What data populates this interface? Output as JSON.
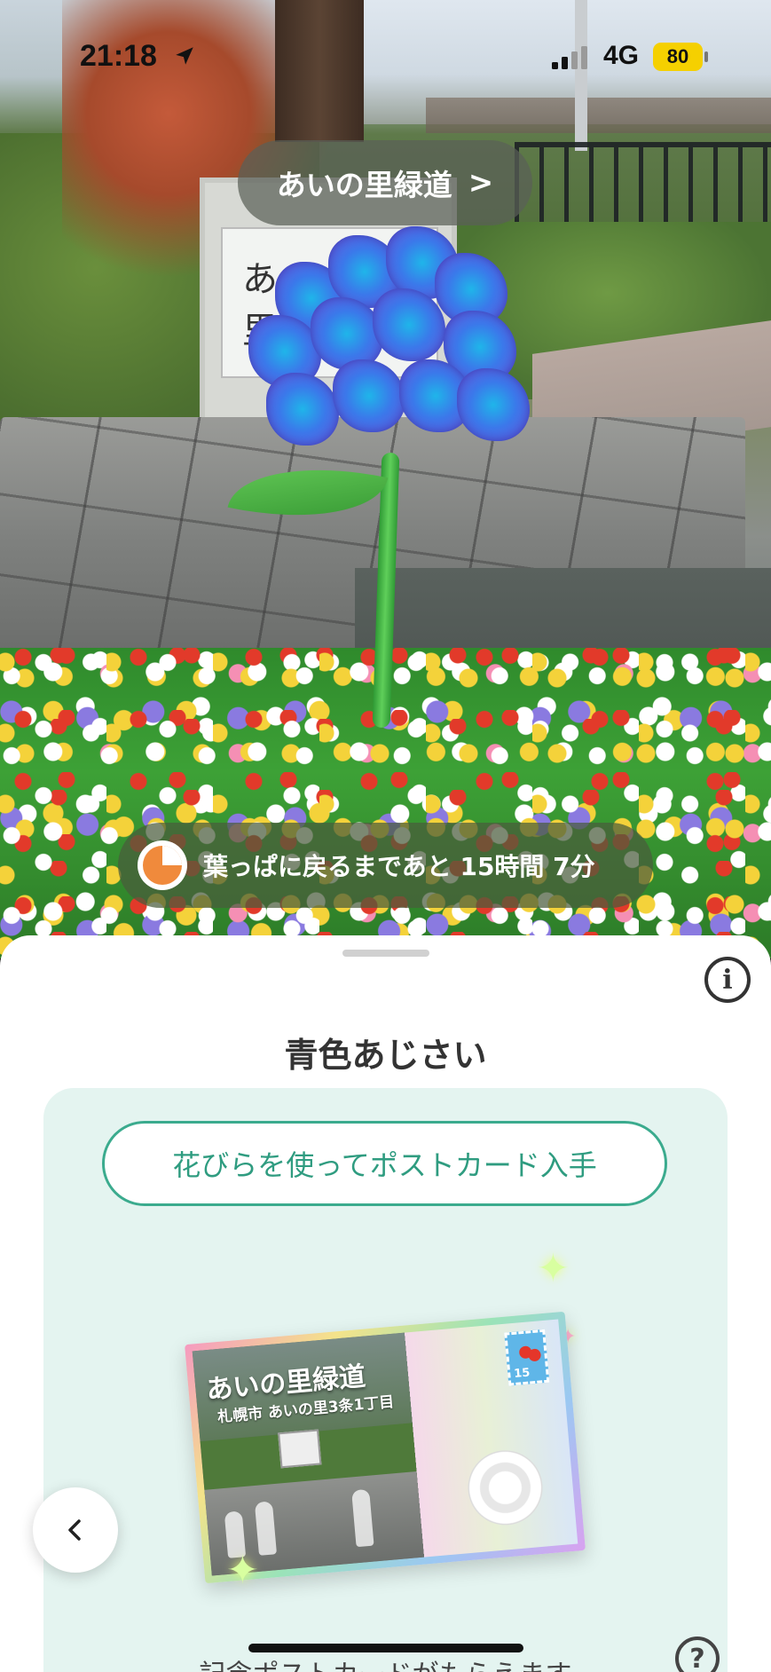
{
  "status_bar": {
    "time": "21:18",
    "network": "4G",
    "battery": "80",
    "battery_color": "#f5d000"
  },
  "location": {
    "name": "あいの里緑道",
    "chevron": ">"
  },
  "scene": {
    "sign_text": "あい の里",
    "flower_color": "#3b78ea"
  },
  "timer": {
    "text": "葉っぱに戻るまであと 15時間 7分",
    "icon": "pie-timer-icon",
    "remaining_fraction": 0.25,
    "accent": "#f08a3c"
  },
  "sheet": {
    "info_label": "i",
    "title": "青色あじさい",
    "postcard_button": "花びらを使ってポストカード入手",
    "accent": "#3bab8e",
    "postcard": {
      "title": "あいの里緑道",
      "address": "札幌市 あいの里3条1丁目",
      "stamp_value": "15"
    },
    "help_label": "?",
    "caption": "記念ポストカードがもらえます"
  },
  "navigation": {
    "back_icon": "chevron-left-icon"
  }
}
